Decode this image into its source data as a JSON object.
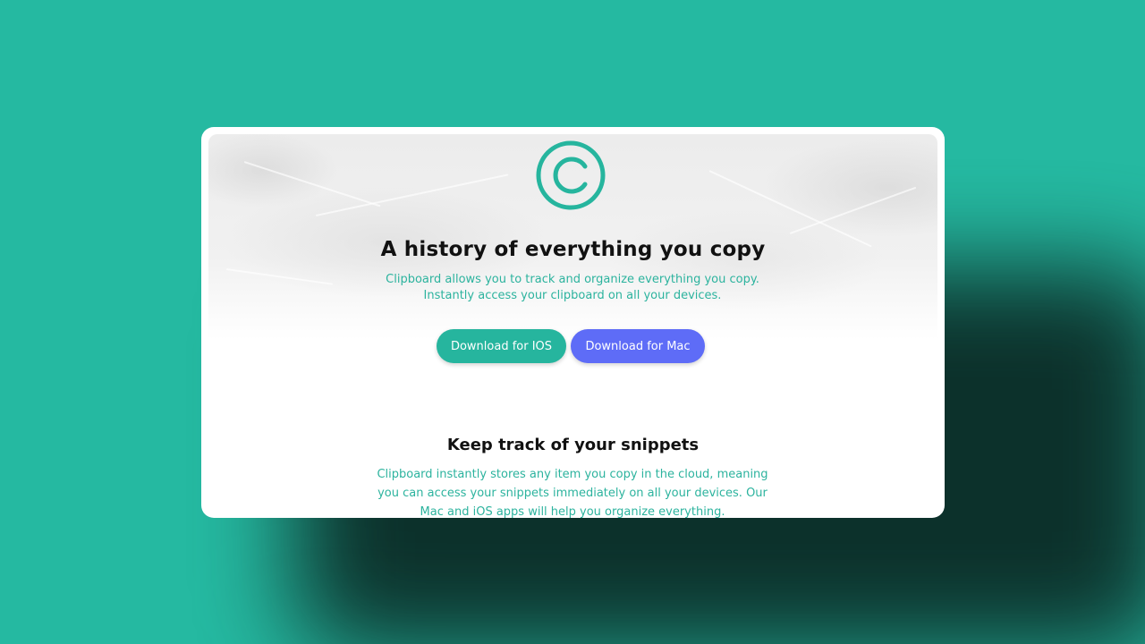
{
  "hero": {
    "title": "A history of everything you copy",
    "description": "Clipboard allows you to track and organize everything you copy. Instantly access your clipboard on all your devices.",
    "ios_button": "Download for IOS",
    "mac_button": "Download for Mac"
  },
  "snippets": {
    "heading": "Keep track of your snippets",
    "text": "Clipboard instantly stores any item you copy in the cloud, meaning you can access your snippets immediately on all your devices. Our Mac and iOS apps will help you organize everything."
  },
  "colors": {
    "background": "#25b9a1",
    "accent_teal": "#26b59e",
    "accent_blue": "#5e6cf7",
    "text_teal": "#2cb39e"
  },
  "icons": {
    "logo": "clipboard-logo-icon"
  }
}
